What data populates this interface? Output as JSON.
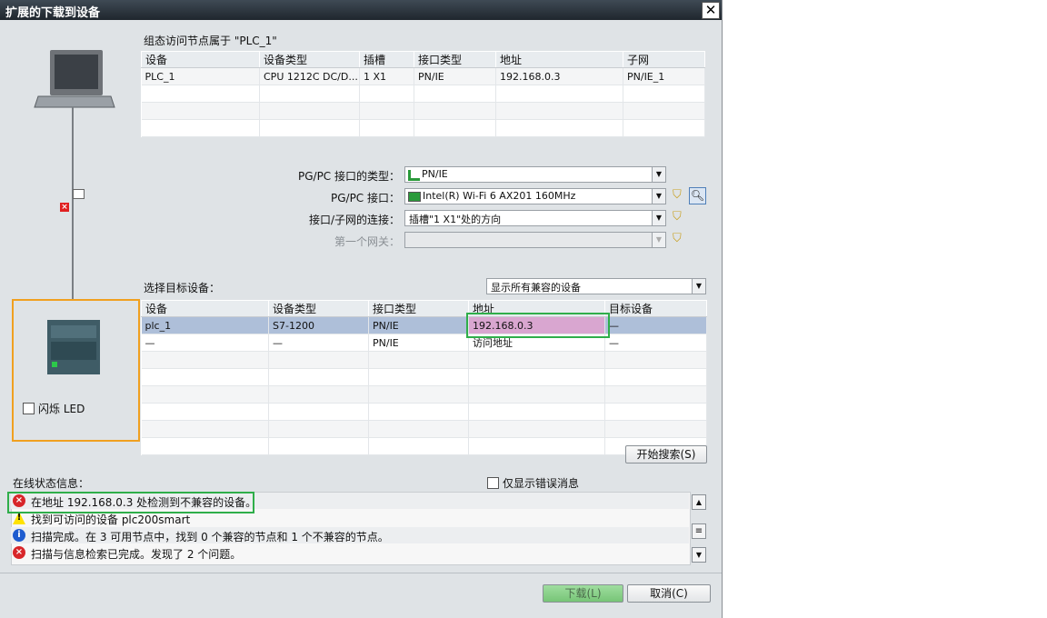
{
  "window": {
    "title": "扩展的下载到设备",
    "close": "✕"
  },
  "config": {
    "heading": "组态访问节点属于 \"PLC_1\"",
    "columns": [
      "设备",
      "设备类型",
      "插槽",
      "接口类型",
      "地址",
      "子网"
    ],
    "rows": [
      [
        "PLC_1",
        "CPU 1212C DC/D...",
        "1 X1",
        "PN/IE",
        "192.168.0.3",
        "PN/IE_1"
      ]
    ]
  },
  "interface": {
    "type_label": "PG/PC 接口的类型：",
    "type_value": "PN/IE",
    "iface_label": "PG/PC 接口：",
    "iface_value": "Intel(R) Wi-Fi 6 AX201 160MHz",
    "conn_label": "接口/子网的连接：",
    "conn_value": "插槽\"1 X1\"处的方向",
    "gateway_label": "第一个网关："
  },
  "target": {
    "label": "选择目标设备：",
    "filter_value": "显示所有兼容的设备",
    "columns": [
      "设备",
      "设备类型",
      "接口类型",
      "地址",
      "目标设备"
    ],
    "rows": [
      [
        "plc_1",
        "S7-1200",
        "PN/IE",
        "192.168.0.3",
        "—"
      ],
      [
        "—",
        "—",
        "PN/IE",
        "访问地址",
        "—"
      ]
    ]
  },
  "flash_led": "闪烁 LED",
  "start_search": "开始搜索(S)",
  "status": {
    "label": "在线状态信息：",
    "errors_only": "仅显示错误消息",
    "messages": [
      {
        "icon": "error-icon",
        "text": "在地址 192.168.0.3 处检测到不兼容的设备。"
      },
      {
        "icon": "warning-icon",
        "text": "找到可访问的设备 plc200smart"
      },
      {
        "icon": "info-icon",
        "text": "扫描完成。在 3 可用节点中，找到 0 个兼容的节点和 1 个不兼容的节点。"
      },
      {
        "icon": "error-icon",
        "text": "扫描与信息检索已完成。发现了 2 个问题。"
      }
    ]
  },
  "buttons": {
    "download": "下载(L)",
    "cancel": "取消(C)"
  },
  "colors": {
    "highlight_green": "#2fae4a",
    "highlight_orange": "#f0a020",
    "selected_row": "#aebfd9"
  }
}
